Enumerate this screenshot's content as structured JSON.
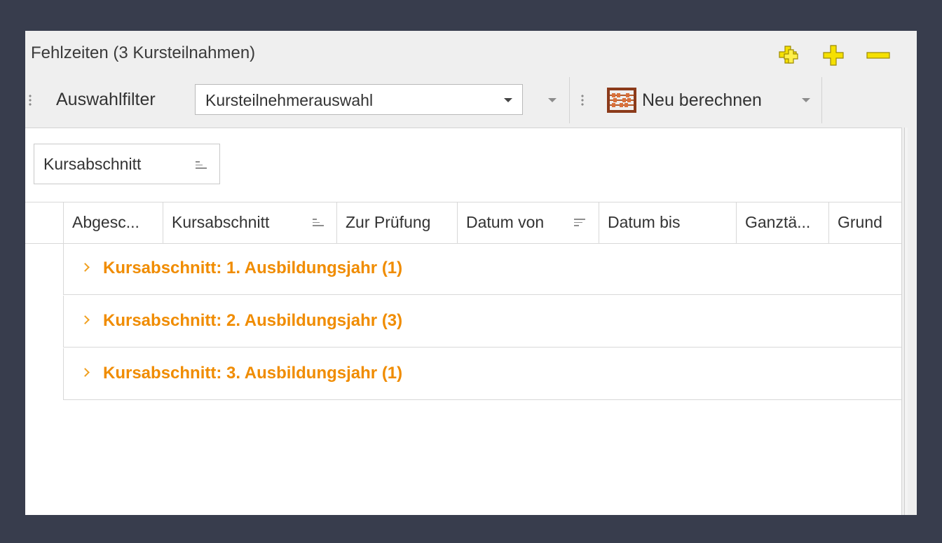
{
  "window": {
    "title": "Fehlzeiten (3 Kursteilnahmen)"
  },
  "title_icons": [
    {
      "name": "add-multiple-icon",
      "color": "#f5e000"
    },
    {
      "name": "add-icon",
      "color": "#f5e000"
    },
    {
      "name": "remove-icon",
      "color": "#f5e000"
    }
  ],
  "toolbar": {
    "filter_label": "Auswahlfilter",
    "filter_value": "Kursteilnehmerauswahl",
    "recalc_label": "Neu berechnen",
    "recalc_icon": "abacus-icon"
  },
  "group_panel": {
    "chip_label": "Kursabschnitt"
  },
  "grid": {
    "columns": [
      {
        "label": "Abgesc..."
      },
      {
        "label": "Kursabschnitt"
      },
      {
        "label": "Zur Prüfung"
      },
      {
        "label": "Datum von"
      },
      {
        "label": "Datum bis"
      },
      {
        "label": "Ganztä..."
      },
      {
        "label": "Grund"
      }
    ],
    "groups": [
      {
        "label": "Kursabschnitt: 1. Ausbildungsjahr (1)"
      },
      {
        "label": "Kursabschnitt: 2. Ausbildungsjahr (3)"
      },
      {
        "label": "Kursabschnitt: 3. Ausbildungsjahr (1)"
      }
    ]
  },
  "colors": {
    "accent": "#f08c00",
    "background": "#383d4d"
  }
}
